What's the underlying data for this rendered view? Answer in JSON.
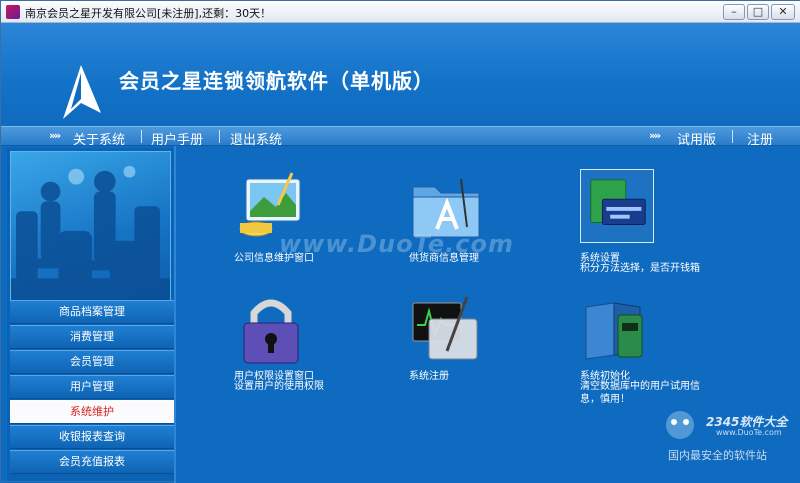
{
  "window": {
    "title": "南京会员之星开发有限公司[未注册],还剩：30天！"
  },
  "window_controls": {
    "minimize": "–",
    "maximize": "□",
    "close": "✕"
  },
  "header": {
    "brand": "会员之星连锁领航软件（单机版）"
  },
  "nav": {
    "left": [
      "关于系统",
      "用户手册",
      "退出系统"
    ],
    "right": [
      "试用版",
      "注册"
    ],
    "arrow_glyph": "»»"
  },
  "sidebar": {
    "items": [
      "商品档案管理",
      "消费管理",
      "会员管理",
      "用户管理",
      "系统维护",
      "收银报表查询",
      "会员充值报表"
    ],
    "active": "系统维护"
  },
  "features": [
    {
      "icon": "company-info-icon",
      "label": "公司信息维护窗口",
      "desc": []
    },
    {
      "icon": "supplier-folder-icon",
      "label": "供货商信息管理",
      "desc": []
    },
    {
      "icon": "system-settings-icon",
      "label": "系统设置",
      "desc": [
        "积分方法选择，是否开钱箱"
      ]
    },
    {
      "icon": "padlock-icon",
      "label": "用户权限设置窗口",
      "desc": [
        "设置用户的使用权限"
      ]
    },
    {
      "icon": "register-monitor-icon",
      "label": "系统注册",
      "desc": []
    },
    {
      "icon": "init-book-icon",
      "label": "系统初始化",
      "desc": [
        "清空数据库中的用户试用信",
        "息，慎用！"
      ]
    }
  ],
  "watermark": {
    "text": "www.DuoTe.com",
    "site": "www.DuoTe.com",
    "brand": "2345软件大全",
    "tagline": "国内最安全的软件站"
  },
  "colors": {
    "accent": "#0f6bbf",
    "active_text": "#d8231d"
  }
}
